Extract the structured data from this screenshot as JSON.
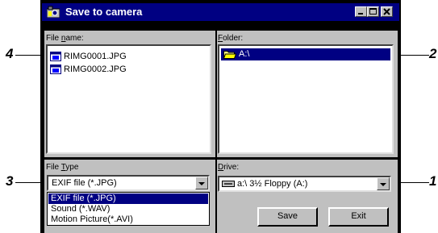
{
  "window": {
    "title": "Save to camera",
    "buttons": [
      "minimize",
      "maximize",
      "close"
    ]
  },
  "file_name_panel": {
    "label_prefix": "File ",
    "label_underlined": "n",
    "label_suffix": "ame:",
    "files": [
      "RIMG0001.JPG",
      "RIMG0002.JPG"
    ],
    "file_icon": "image-file-icon"
  },
  "folder_panel": {
    "label_underlined": "F",
    "label_suffix": "older:",
    "items": [
      {
        "label": "A:\\",
        "icon": "open-folder-icon",
        "selected": true
      }
    ]
  },
  "file_type_panel": {
    "label_prefix": "File ",
    "label_underlined": "T",
    "label_suffix": "ype",
    "selected": "EXIF file (*.JPG)",
    "options": [
      "EXIF file (*.JPG)",
      "Sound   (*.WAV)",
      "Motion Picture(*.AVI)"
    ]
  },
  "drive_panel": {
    "label_underlined": "D",
    "label_suffix": "rive:",
    "selected": "a:\\ 3½ Floppy (A:)",
    "icon": "floppy-drive-icon"
  },
  "actions": {
    "save_label": "Save",
    "exit_label": "Exit"
  },
  "callouts": [
    "1",
    "2",
    "3",
    "4"
  ],
  "colors": {
    "titlebar": "#000082",
    "panel": "#c0c0c0",
    "selection": "#000082"
  }
}
